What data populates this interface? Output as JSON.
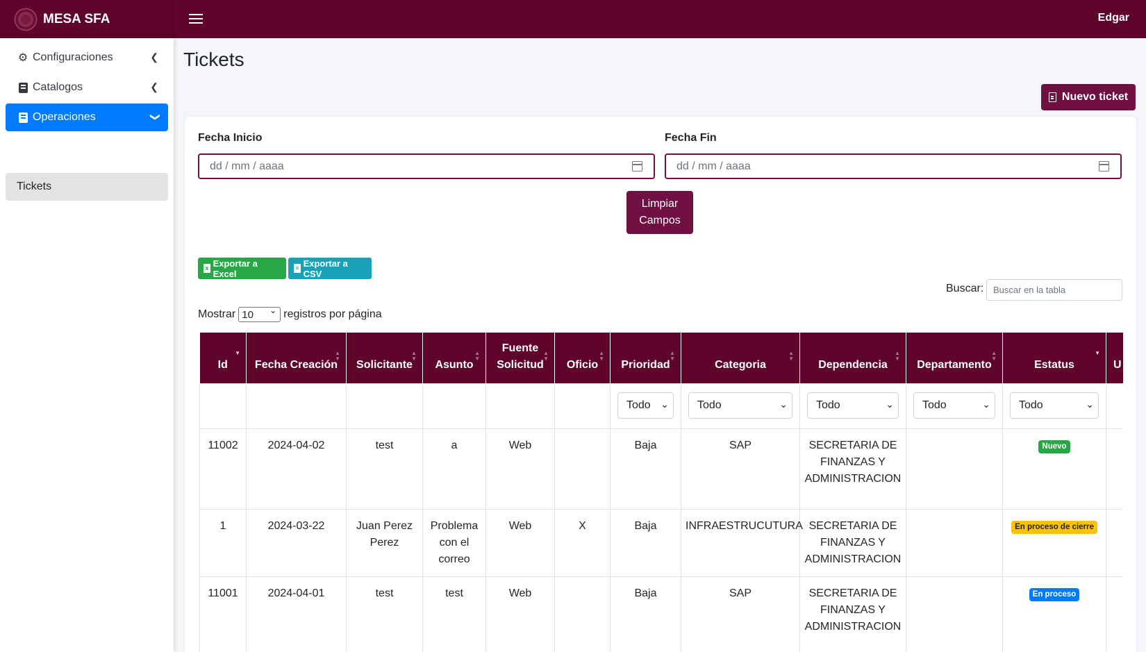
{
  "app": {
    "brand": "MESA SFA",
    "user": "Edgar"
  },
  "sidebar": {
    "items": [
      {
        "label": "Configuraciones",
        "icon": "gear-icon"
      },
      {
        "label": "Catalogos",
        "icon": "book-icon"
      },
      {
        "label": "Operaciones",
        "icon": "book-icon"
      }
    ],
    "sub": {
      "label": "Tickets"
    }
  },
  "page": {
    "title": "Tickets",
    "new_button": "Nuevo ticket"
  },
  "filters": {
    "start_label": "Fecha Inicio",
    "end_label": "Fecha Fin",
    "date_placeholder": "dd / mm / aaaa",
    "clear_line1": "Limpiar",
    "clear_line2": "Campos"
  },
  "toolbar": {
    "excel": "Exportar a Excel",
    "csv": "Exportar a CSV",
    "search_label": "Buscar:",
    "search_placeholder": "Buscar en la tabla",
    "show": "Mostrar",
    "length": "10",
    "per_page": "registros por página"
  },
  "table": {
    "headers": [
      "Id",
      "Fecha Creación",
      "Solicitante",
      "Asunto",
      "Fuente Solicitud",
      "Oficio",
      "Prioridad",
      "Categoria",
      "Dependencia",
      "Departamento",
      "Estatus",
      "U"
    ],
    "filter_value": "Todo",
    "rows": [
      {
        "id": "11002",
        "fecha": "2024-04-02",
        "solicitante": "test",
        "asunto": "a",
        "fuente": "Web",
        "oficio": "",
        "prioridad": "Baja",
        "categoria": "SAP",
        "dependencia": "SECRETARIA DE FINANZAS Y ADMINISTRACION",
        "departamento": "",
        "estatus": "Nuevo",
        "estatus_color": "#28a745",
        "estatus_text_color": "#ffffff"
      },
      {
        "id": "1",
        "fecha": "2024-03-22",
        "solicitante": "Juan Perez Perez",
        "asunto": "Problema con el correo",
        "fuente": "Web",
        "oficio": "X",
        "prioridad": "Baja",
        "categoria": "INFRAESTRUCUTURA",
        "dependencia": "SECRETARIA DE FINANZAS Y ADMINISTRACION",
        "departamento": "",
        "estatus": "En proceso de cierre",
        "estatus_color": "#ffc107",
        "estatus_text_color": "#212529"
      },
      {
        "id": "11001",
        "fecha": "2024-04-01",
        "solicitante": "test",
        "asunto": "test",
        "fuente": "Web",
        "oficio": "",
        "prioridad": "Baja",
        "categoria": "SAP",
        "dependencia": "SECRETARIA DE FINANZAS Y ADMINISTRACION",
        "departamento": "",
        "estatus": "En proceso",
        "estatus_color": "#007bff",
        "estatus_text_color": "#ffffff"
      }
    ]
  },
  "colors": {
    "primary": "#5f052b",
    "button": "#6f0f42",
    "active": "#007bff",
    "excel": "#28a745",
    "csv": "#17a2b8"
  }
}
